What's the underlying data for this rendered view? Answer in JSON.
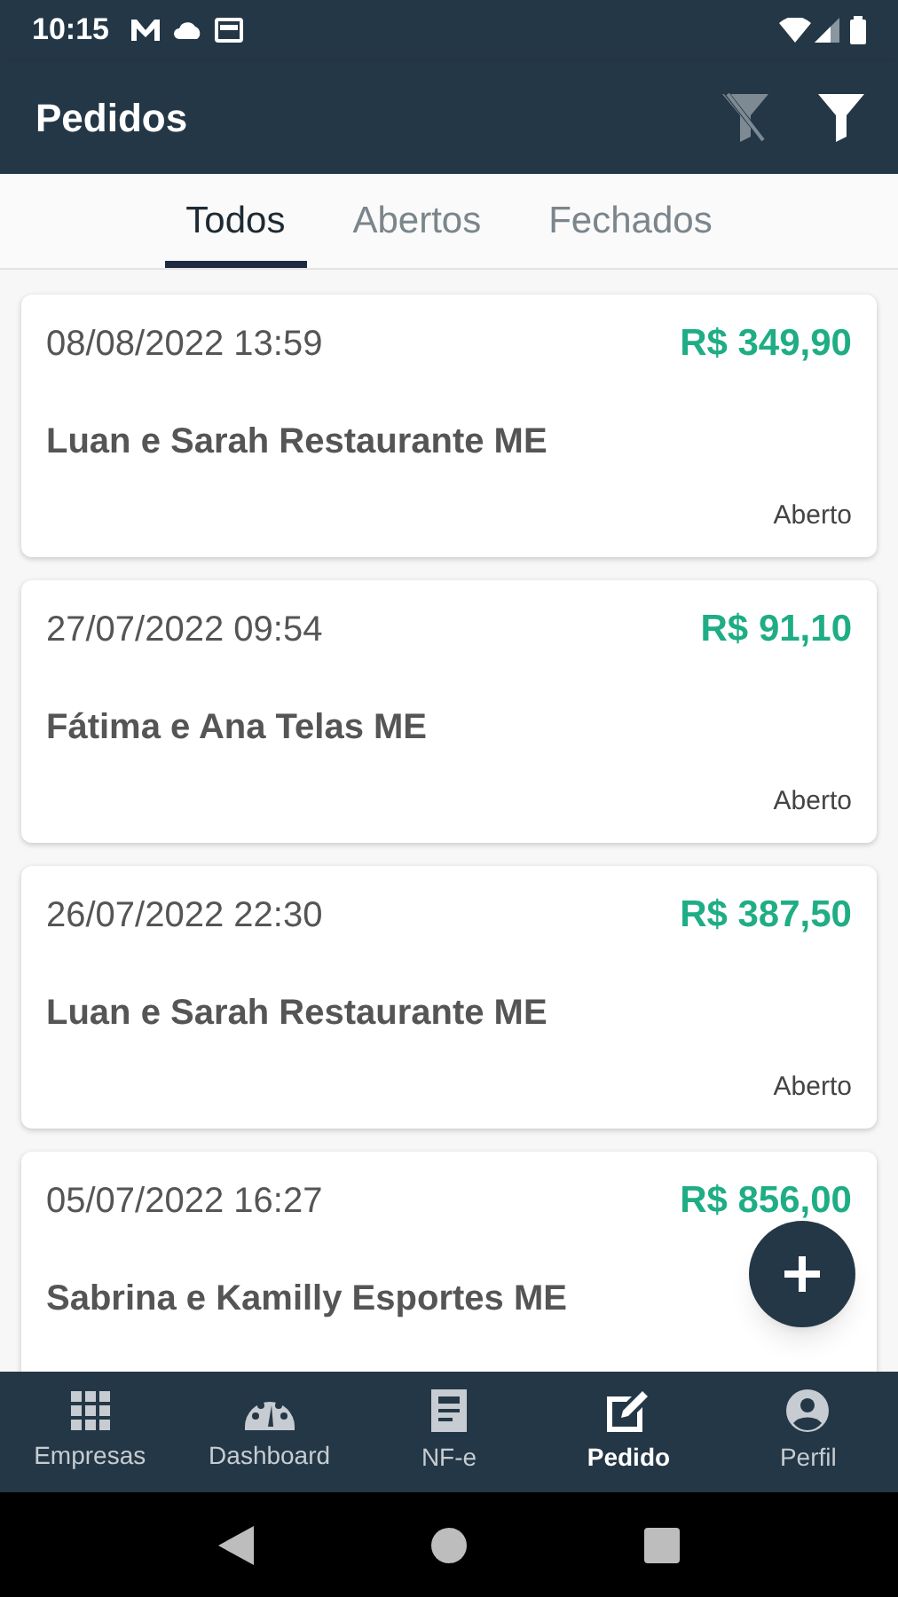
{
  "status_bar": {
    "time": "10:15"
  },
  "app_bar": {
    "title": "Pedidos"
  },
  "tabs": [
    {
      "label": "Todos",
      "selected": true
    },
    {
      "label": "Abertos",
      "selected": false
    },
    {
      "label": "Fechados",
      "selected": false
    }
  ],
  "orders": [
    {
      "date": "08/08/2022 13:59",
      "total": "R$ 349,90",
      "customer": "Luan e Sarah Restaurante ME",
      "status": "Aberto"
    },
    {
      "date": "27/07/2022 09:54",
      "total": "R$ 91,10",
      "customer": "Fátima e Ana Telas ME",
      "status": "Aberto"
    },
    {
      "date": "26/07/2022 22:30",
      "total": "R$ 387,50",
      "customer": "Luan e Sarah Restaurante ME",
      "status": "Aberto"
    },
    {
      "date": "05/07/2022 16:27",
      "total": "R$ 856,00",
      "customer": "Sabrina e Kamilly Esportes ME"
    }
  ],
  "bottom_nav": [
    {
      "kind": "grid",
      "label": "Empresas",
      "selected": false
    },
    {
      "kind": "gauge",
      "label": "Dashboard",
      "selected": false
    },
    {
      "kind": "doc",
      "label": "NF-e",
      "selected": false
    },
    {
      "kind": "edit",
      "label": "Pedido",
      "selected": true
    },
    {
      "kind": "person",
      "label": "Perfil",
      "selected": false
    }
  ]
}
